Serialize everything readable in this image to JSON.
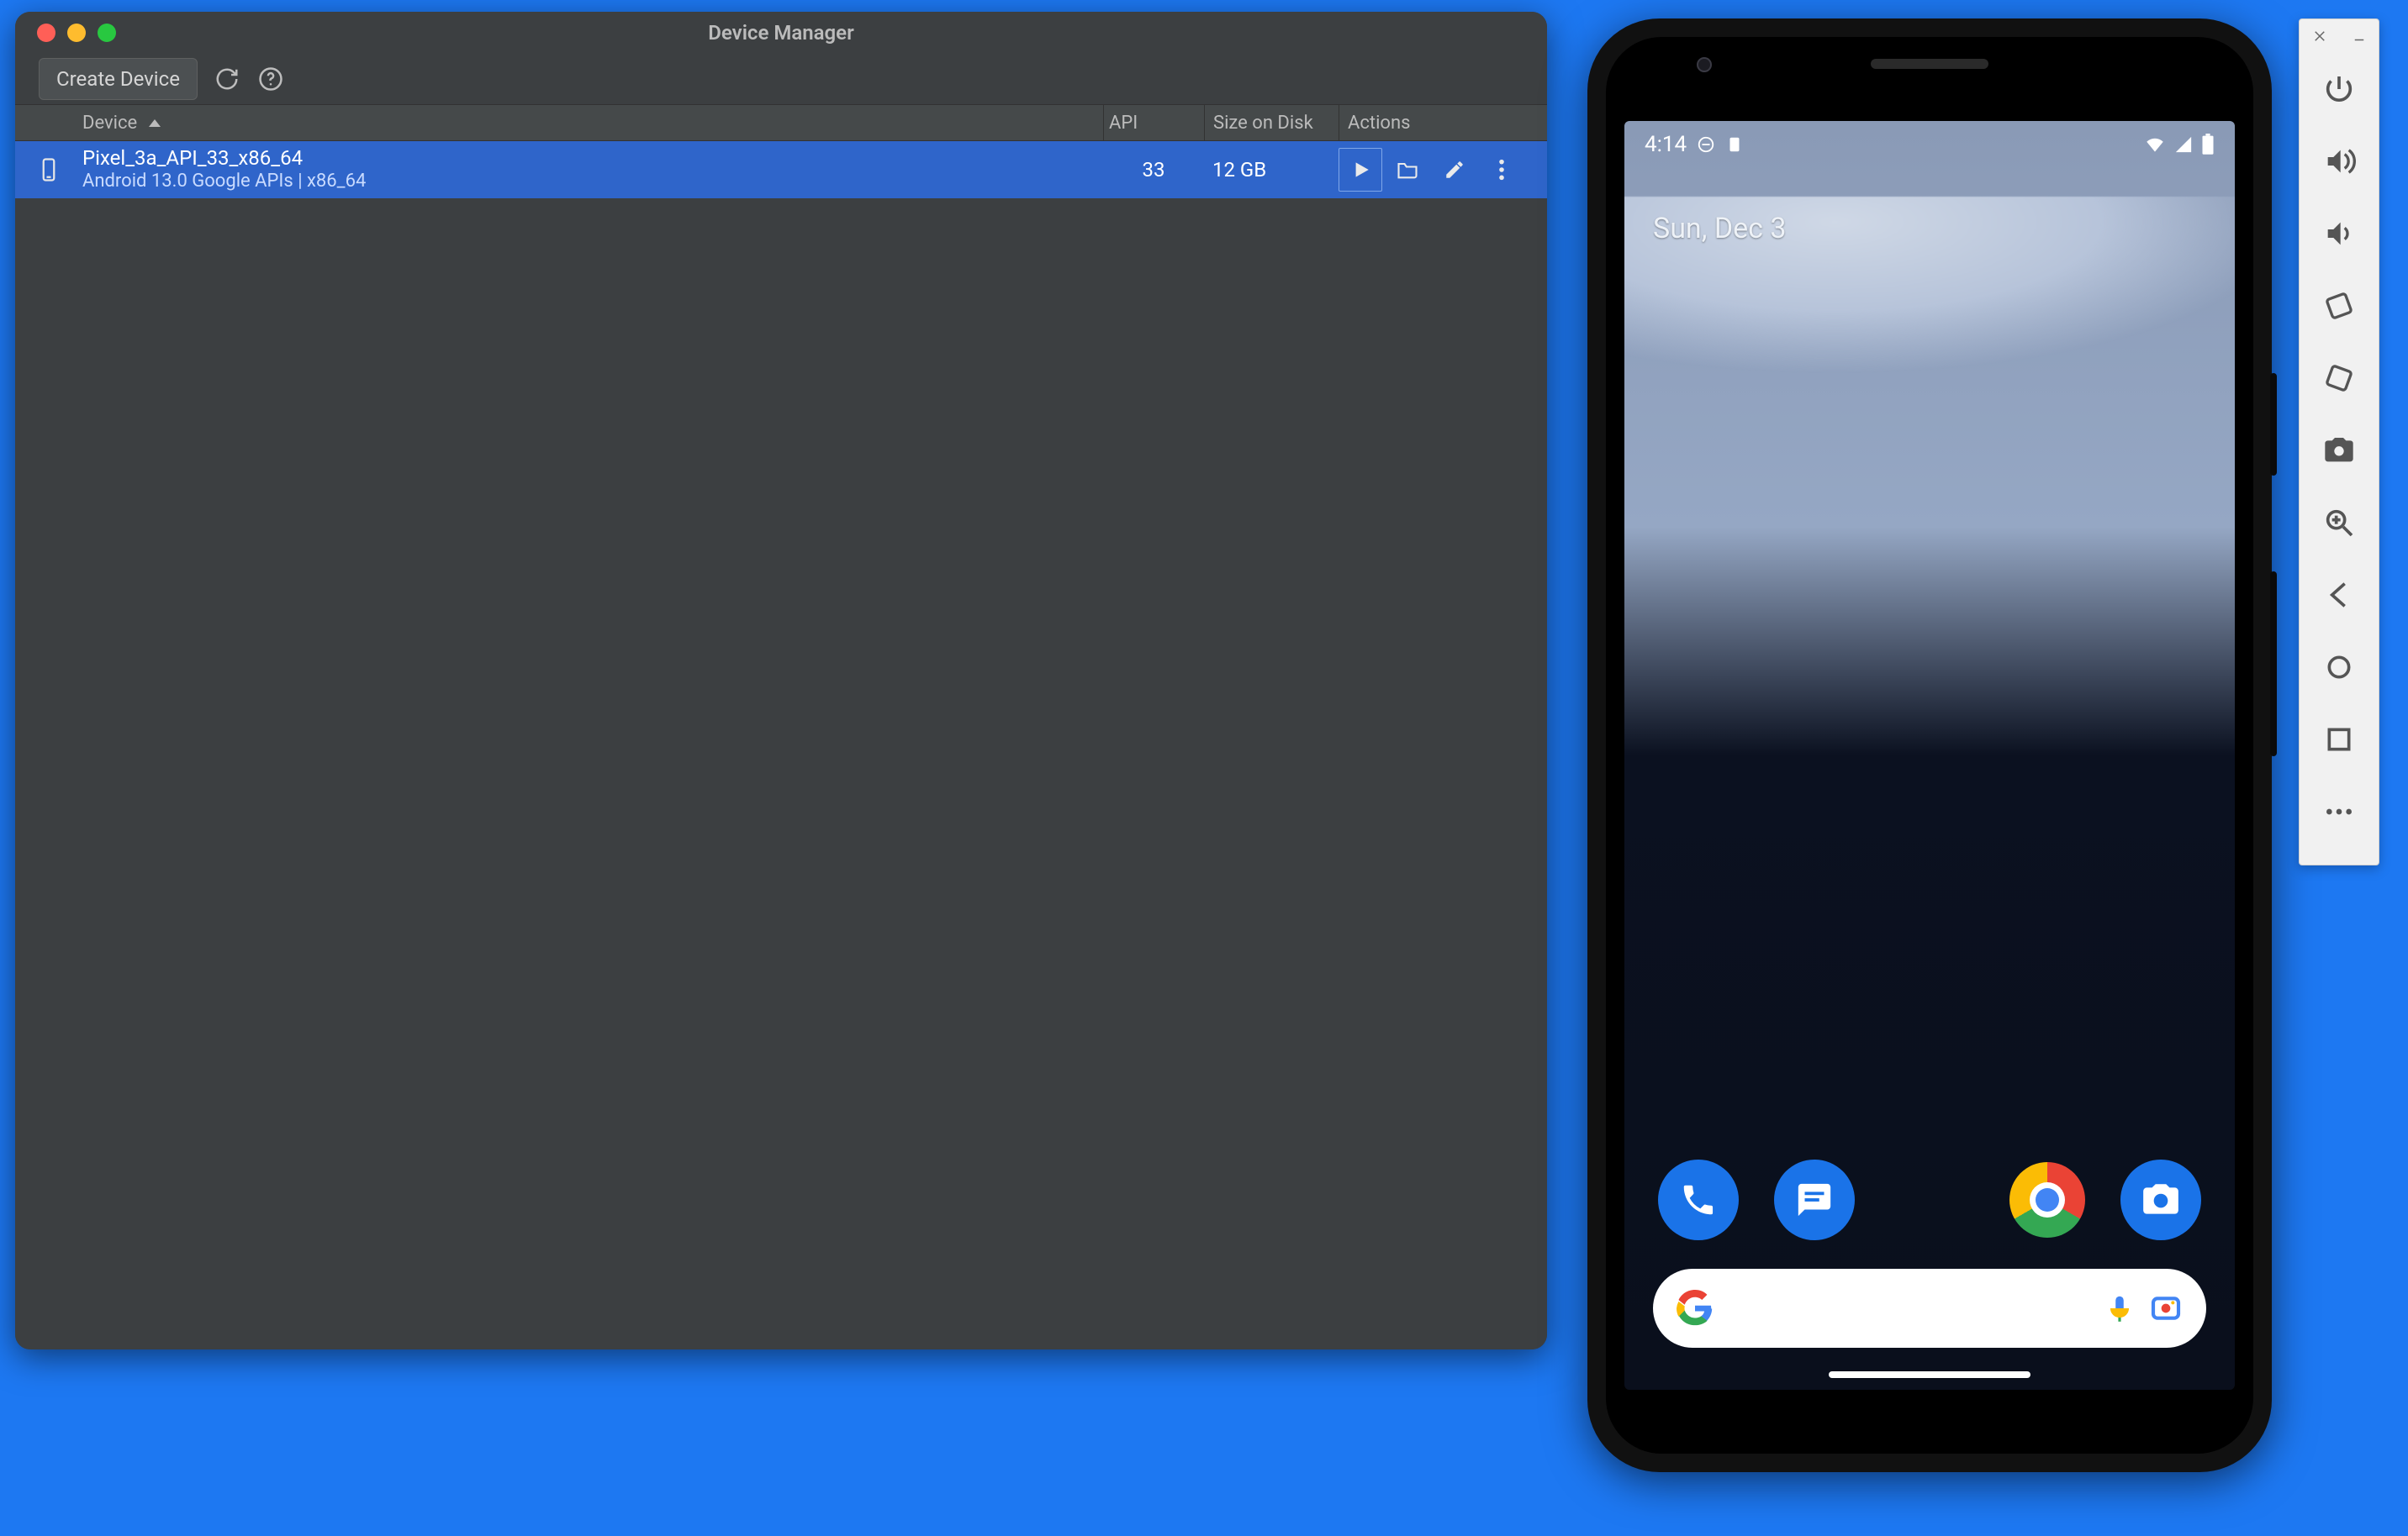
{
  "deviceManager": {
    "title": "Device Manager",
    "createButton": "Create Device",
    "columns": {
      "device": "Device",
      "api": "API",
      "size": "Size on Disk",
      "actions": "Actions"
    },
    "devices": [
      {
        "name": "Pixel_3a_API_33_x86_64",
        "subtitle": "Android 13.0 Google APIs | x86_64",
        "api": "33",
        "size": "12 GB"
      }
    ]
  },
  "emulator": {
    "statusbar": {
      "time": "4:14"
    },
    "dateLabel": "Sun, Dec 3",
    "toolbarIcons": [
      "power",
      "volume-up",
      "volume-down",
      "rotate-left",
      "rotate-right",
      "screenshot",
      "zoom",
      "back",
      "home",
      "overview",
      "more"
    ]
  }
}
